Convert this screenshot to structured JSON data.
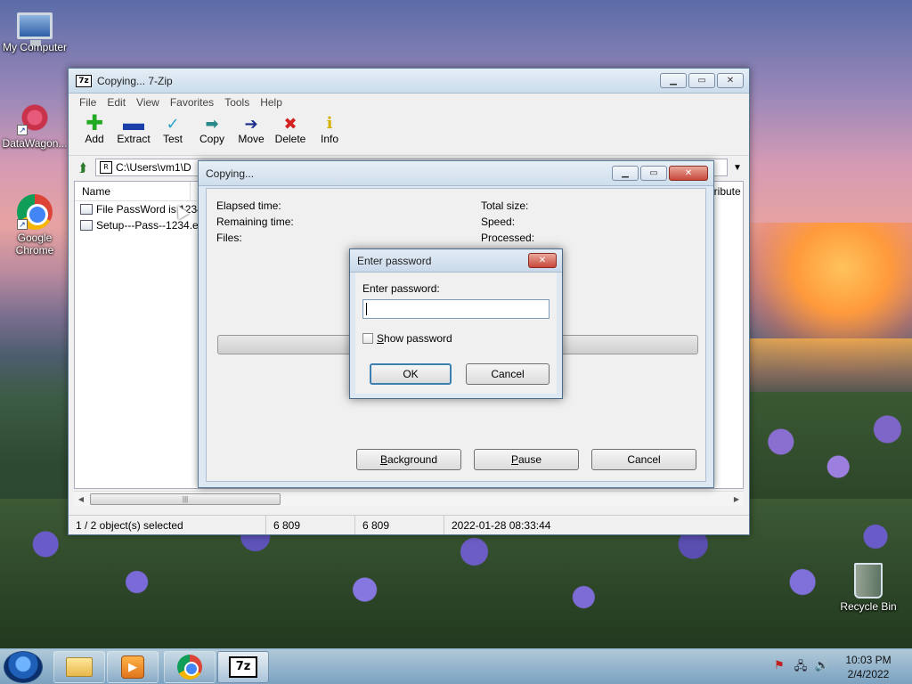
{
  "desktop": {
    "icons": [
      {
        "label": "My Computer"
      },
      {
        "label": "DataWagon..."
      },
      {
        "label": "Google Chrome"
      },
      {
        "label": "Recycle Bin"
      }
    ]
  },
  "main_window": {
    "title": "Copying... 7-Zip",
    "app_icon": "7z",
    "menu": [
      "File",
      "Edit",
      "View",
      "Favorites",
      "Tools",
      "Help"
    ],
    "toolbar": [
      {
        "label": "Add",
        "icon": "plus-icon",
        "color": "#22aa22"
      },
      {
        "label": "Extract",
        "icon": "minus-icon",
        "color": "#1a3fa8"
      },
      {
        "label": "Test",
        "icon": "check-icon",
        "color": "#2aa6c8"
      },
      {
        "label": "Copy",
        "icon": "double-arrow-icon",
        "color": "#2a8a8a"
      },
      {
        "label": "Move",
        "icon": "arrow-right-icon",
        "color": "#1a2a8a"
      },
      {
        "label": "Delete",
        "icon": "x-icon",
        "color": "#d42020"
      },
      {
        "label": "Info",
        "icon": "info-icon",
        "color": "#d4b000"
      }
    ],
    "address": "C:\\Users\\vm1\\D",
    "address_icon": "R",
    "columns": {
      "name": "Name",
      "attributes": "ttribute"
    },
    "files": [
      {
        "name": "File PassWord is 1234."
      },
      {
        "name": "Setup---Pass--1234.ex"
      }
    ],
    "status": {
      "selection": "1 / 2 object(s) selected",
      "size": "6 809",
      "packed": "6 809",
      "modified": "2022-01-28 08:33:44"
    }
  },
  "copy_dialog": {
    "title": "Copying...",
    "left_labels": [
      "Elapsed time:",
      "Remaining time:",
      "Files:"
    ],
    "right_labels": [
      "Total size:",
      "Speed:",
      "Processed:"
    ],
    "buttons": {
      "background": "Background",
      "pause": "Pause",
      "cancel": "Cancel"
    }
  },
  "password_dialog": {
    "title": "Enter password",
    "prompt": "Enter password:",
    "value": "",
    "show_password_label": "Show password",
    "show_password_checked": false,
    "ok": "OK",
    "cancel": "Cancel"
  },
  "taskbar": {
    "clock_time": "10:03 PM",
    "clock_date": "2/4/2022",
    "apps": [
      {
        "name": "windows-explorer"
      },
      {
        "name": "media-player"
      },
      {
        "name": "google-chrome"
      },
      {
        "name": "7-zip",
        "label": "7z"
      }
    ]
  }
}
